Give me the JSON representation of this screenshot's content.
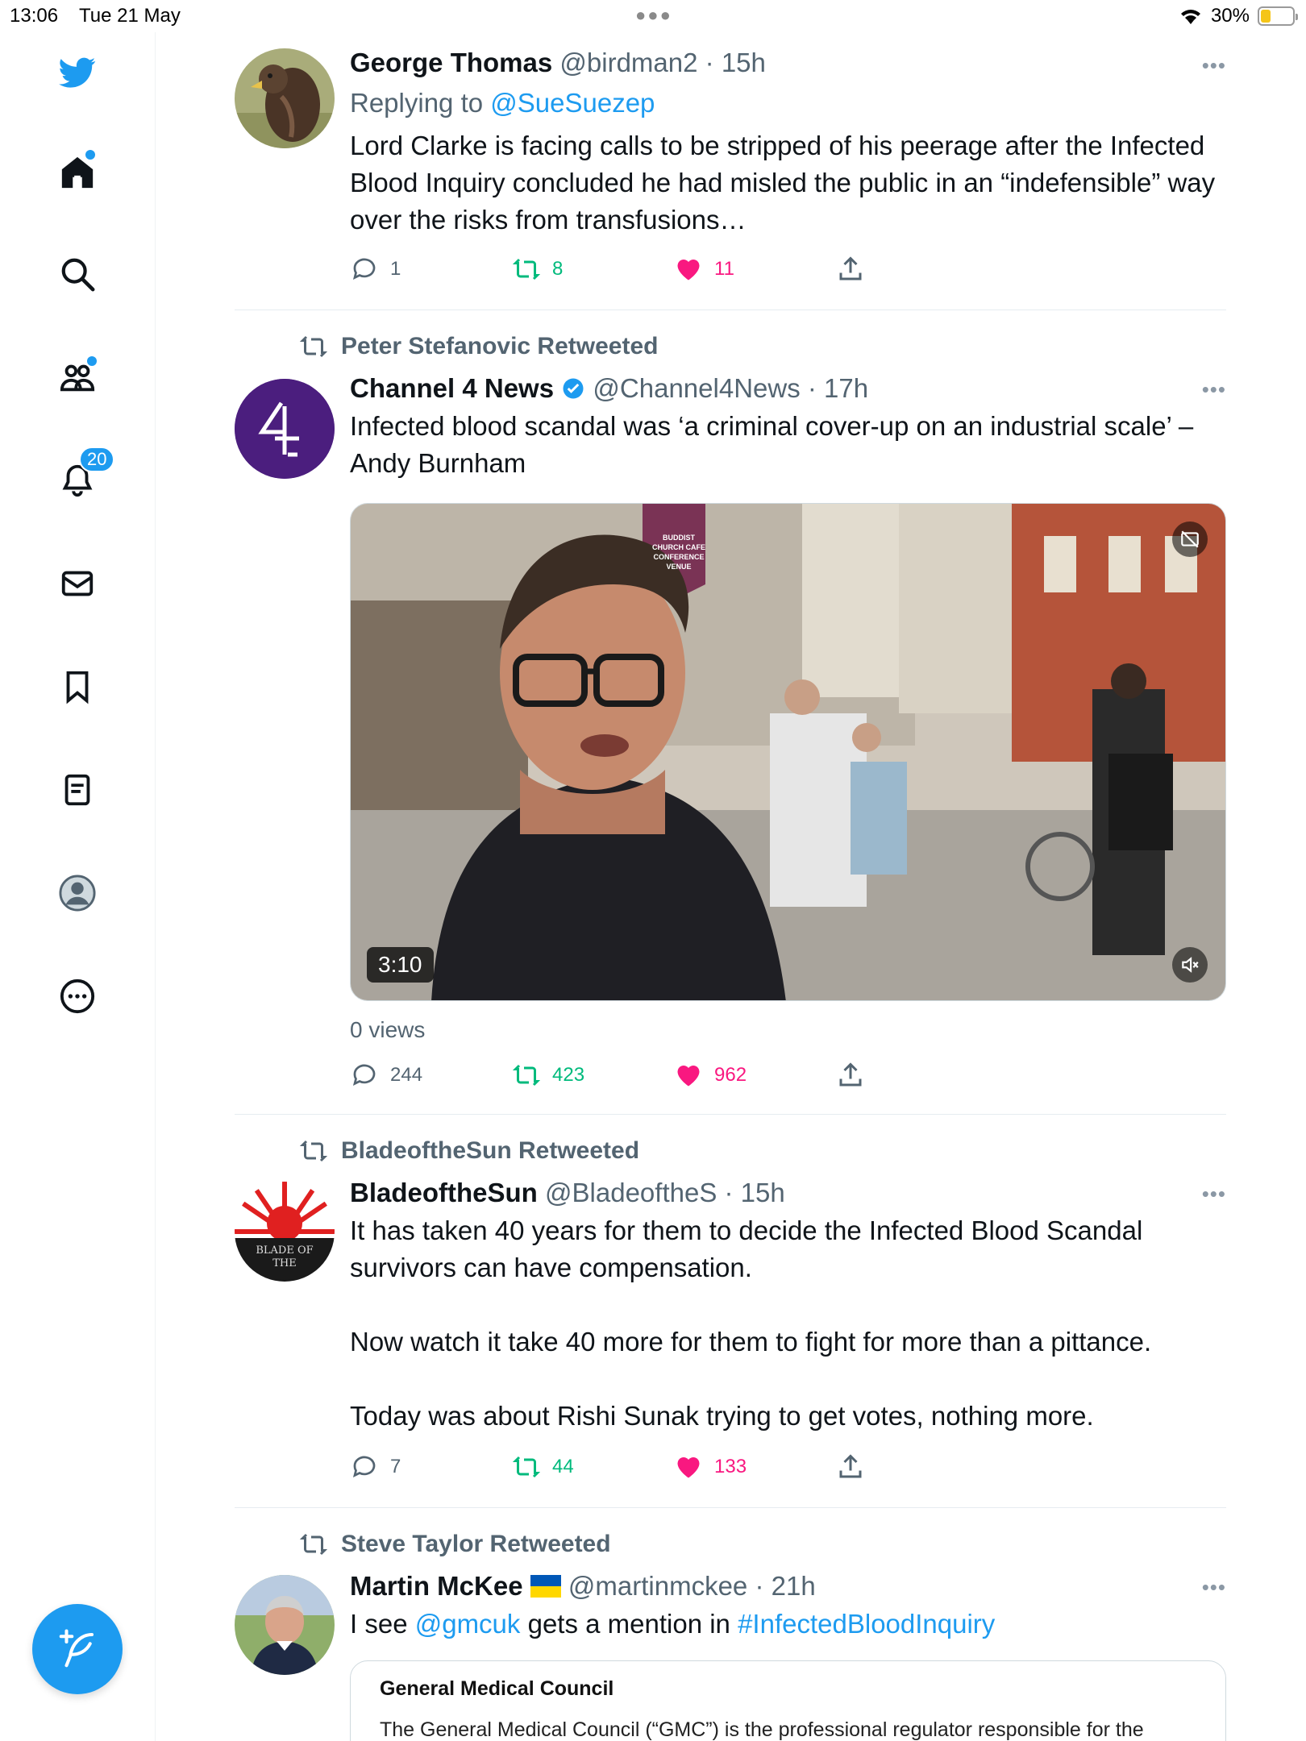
{
  "status_bar": {
    "time": "13:06",
    "date": "Tue 21 May",
    "battery": "30%"
  },
  "sidebar": {
    "notifications_badge": "20"
  },
  "tweets": [
    {
      "name": "George Thomas",
      "handle": "@birdman2",
      "time": "· 15h",
      "replying_prefix": "Replying to ",
      "replying_to": "@SueSuezep",
      "text": "Lord Clarke is facing calls to be stripped of his peerage after the Infected Blood Inquiry concluded he had misled the public in an “indefensible” way over the risks from transfusions…",
      "replies": "1",
      "retweets": "8",
      "likes": "11"
    },
    {
      "retweeted_by": "Peter Stefanovic Retweeted",
      "name": "Channel 4 News",
      "handle": "@Channel4News",
      "time": "· 17h",
      "text": "Infected blood scandal was ‘a criminal cover-up on an industrial scale’ – Andy Burnham",
      "video_duration": "3:10",
      "views": "0 views",
      "banner_text": "BUDDIST CHURCH CAFE CONFERENCE VENUE",
      "replies": "244",
      "retweets": "423",
      "likes": "962"
    },
    {
      "retweeted_by": "BladeoftheSun Retweeted",
      "name": "BladeoftheSun",
      "handle": "@BladeoftheS",
      "time": "· 15h",
      "avatar_text": "BLADE OF THE",
      "text": "It has taken 40 years for them to decide the Infected Blood Scandal survivors can have compensation.\n\nNow watch it take 40 more for them to fight for more than a pittance.\n\nToday was about Rishi Sunak trying to get votes, nothing more.",
      "replies": "7",
      "retweets": "44",
      "likes": "133"
    },
    {
      "retweeted_by": "Steve Taylor Retweeted",
      "name": "Martin McKee",
      "handle": "@martinmckee",
      "time": "· 21h",
      "text_prefix": "I see ",
      "mention": "@gmcuk",
      "text_middle": " gets a mention in ",
      "hashtag": "#InfectedBloodInquiry",
      "card_title": "General Medical Council",
      "card_text": "The General Medical Council (“GMC”) is the professional regulator responsible for the"
    }
  ],
  "colors": {
    "accent": "#1d9bf0",
    "retweet": "#00ba7c",
    "like": "#f91880",
    "muted": "#536471"
  }
}
